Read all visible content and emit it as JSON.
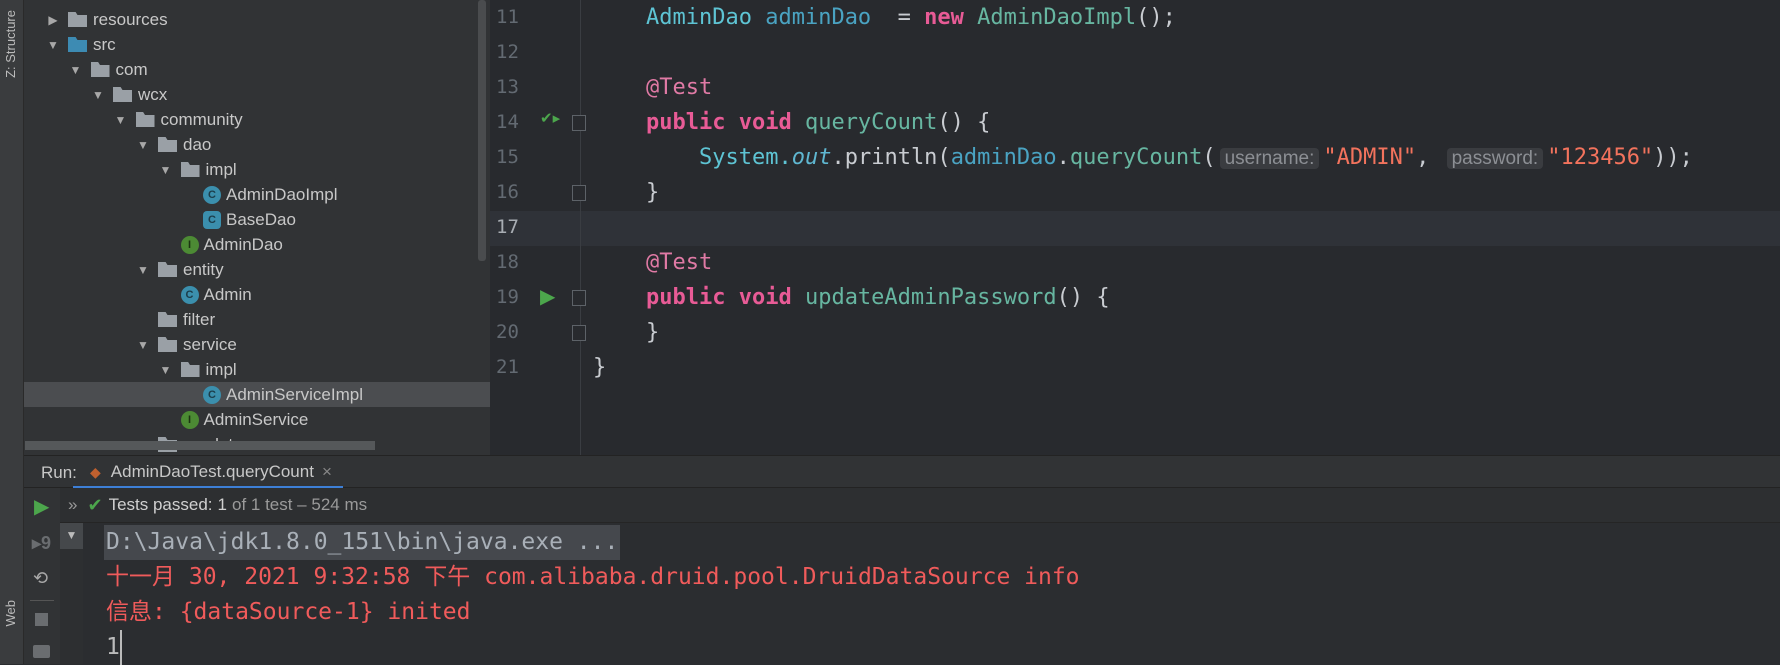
{
  "side_strip": {
    "structure": "Z: Structure",
    "web": "Web"
  },
  "tree": [
    {
      "level": 0,
      "arrow": "right",
      "icon": "res",
      "label": "resources"
    },
    {
      "level": 0,
      "arrow": "down",
      "icon": "src",
      "label": "src"
    },
    {
      "level": 1,
      "arrow": "down",
      "icon": "pkg",
      "label": "com"
    },
    {
      "level": 2,
      "arrow": "down",
      "icon": "pkg",
      "label": "wcx"
    },
    {
      "level": 3,
      "arrow": "down",
      "icon": "pkg",
      "label": "community"
    },
    {
      "level": 4,
      "arrow": "down",
      "icon": "pkg",
      "label": "dao"
    },
    {
      "level": 5,
      "arrow": "down",
      "icon": "pkg",
      "label": "impl"
    },
    {
      "level": 6,
      "arrow": "",
      "icon": "c",
      "label": "AdminDaoImpl"
    },
    {
      "level": 6,
      "arrow": "",
      "icon": "a",
      "label": "BaseDao"
    },
    {
      "level": 5,
      "arrow": "",
      "icon": "i",
      "label": "AdminDao"
    },
    {
      "level": 4,
      "arrow": "down",
      "icon": "pkg",
      "label": "entity"
    },
    {
      "level": 5,
      "arrow": "",
      "icon": "c",
      "label": "Admin"
    },
    {
      "level": 4,
      "arrow": "",
      "icon": "pkg",
      "label": "filter"
    },
    {
      "level": 4,
      "arrow": "down",
      "icon": "pkg",
      "label": "service"
    },
    {
      "level": 5,
      "arrow": "down",
      "icon": "pkg",
      "label": "impl"
    },
    {
      "level": 6,
      "arrow": "",
      "icon": "c",
      "label": "AdminServiceImpl",
      "selected": true
    },
    {
      "level": 5,
      "arrow": "",
      "icon": "i",
      "label": "AdminService"
    },
    {
      "level": 4,
      "arrow": "",
      "icon": "pkg",
      "label": "servlet"
    }
  ],
  "editor": {
    "current_line": 17,
    "lines": [
      {
        "n": "11",
        "indent": 1,
        "tokens": [
          [
            "ty",
            "AdminDao "
          ],
          [
            "fd",
            "adminDao"
          ],
          [
            "",
            "  = "
          ],
          [
            "kw",
            "new "
          ],
          [
            "fn",
            "AdminDaoImpl"
          ],
          [
            "",
            "();"
          ]
        ]
      },
      {
        "n": "12",
        "indent": 0,
        "tokens": []
      },
      {
        "n": "13",
        "indent": 1,
        "tokens": [
          [
            "an",
            "@Test"
          ]
        ]
      },
      {
        "n": "14",
        "indent": 1,
        "gutter": "run-passed",
        "fold": true,
        "tokens": [
          [
            "kw",
            "public void "
          ],
          [
            "fn",
            "queryCount"
          ],
          [
            "",
            "() {"
          ]
        ]
      },
      {
        "n": "15",
        "indent": 2,
        "tokens": [
          [
            "ty",
            "System."
          ],
          [
            "it",
            "out"
          ],
          [
            "",
            ".println("
          ],
          [
            "fd",
            "adminDao"
          ],
          [
            "",
            "."
          ],
          [
            "fn",
            "queryCount"
          ],
          [
            "",
            "("
          ],
          [
            "hint",
            "username:"
          ],
          [
            "st",
            "\"ADMIN\""
          ],
          [
            "",
            ", "
          ],
          [
            "hint",
            "password:"
          ],
          [
            "st",
            "\"123456\""
          ],
          [
            "",
            "));"
          ]
        ]
      },
      {
        "n": "16",
        "indent": 1,
        "fold": true,
        "tokens": [
          [
            "",
            "}"
          ]
        ]
      },
      {
        "n": "17",
        "indent": 0,
        "tokens": []
      },
      {
        "n": "18",
        "indent": 1,
        "tokens": [
          [
            "an",
            "@Test"
          ]
        ]
      },
      {
        "n": "19",
        "indent": 1,
        "gutter": "run",
        "fold": true,
        "tokens": [
          [
            "kw",
            "public void "
          ],
          [
            "fn",
            "updateAdminPassword"
          ],
          [
            "",
            "() {"
          ]
        ]
      },
      {
        "n": "20",
        "indent": 1,
        "fold": true,
        "tokens": [
          [
            "",
            "}"
          ]
        ]
      },
      {
        "n": "21",
        "indent": 0,
        "tokens": [
          [
            "",
            "}"
          ]
        ]
      }
    ]
  },
  "run": {
    "label": "Run:",
    "tab": "AdminDaoTest.queryCount",
    "close": "×",
    "status_prefix": "»",
    "status_bold": "Tests passed:",
    "status_count": "1",
    "status_rest": "of 1 test – 524 ms"
  },
  "console": [
    {
      "text": "D:\\Java\\jdk1.8.0_151\\bin\\java.exe ...",
      "color": "#a9b0b8",
      "highlight": true
    },
    {
      "text": "十一月 30, 2021 9:32:58 下午 com.alibaba.druid.pool.DruidDataSource info",
      "color": "#f05b5b"
    },
    {
      "text": "信息: {dataSource-1} inited",
      "color": "#f05b5b"
    },
    {
      "text": "1",
      "color": "#bbbbbb",
      "caret": true
    }
  ]
}
